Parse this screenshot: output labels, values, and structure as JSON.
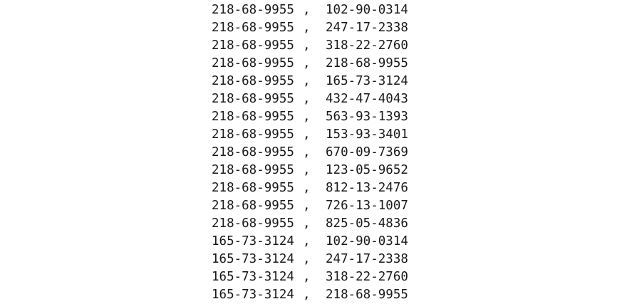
{
  "output": {
    "separator": ",",
    "rows": [
      {
        "left": "218-68-9955",
        "right": "102-90-0314"
      },
      {
        "left": "218-68-9955",
        "right": "247-17-2338"
      },
      {
        "left": "218-68-9955",
        "right": "318-22-2760"
      },
      {
        "left": "218-68-9955",
        "right": "218-68-9955"
      },
      {
        "left": "218-68-9955",
        "right": "165-73-3124"
      },
      {
        "left": "218-68-9955",
        "right": "432-47-4043"
      },
      {
        "left": "218-68-9955",
        "right": "563-93-1393"
      },
      {
        "left": "218-68-9955",
        "right": "153-93-3401"
      },
      {
        "left": "218-68-9955",
        "right": "670-09-7369"
      },
      {
        "left": "218-68-9955",
        "right": "123-05-9652"
      },
      {
        "left": "218-68-9955",
        "right": "812-13-2476"
      },
      {
        "left": "218-68-9955",
        "right": "726-13-1007"
      },
      {
        "left": "218-68-9955",
        "right": "825-05-4836"
      },
      {
        "left": "165-73-3124",
        "right": "102-90-0314"
      },
      {
        "left": "165-73-3124",
        "right": "247-17-2338"
      },
      {
        "left": "165-73-3124",
        "right": "318-22-2760"
      },
      {
        "left": "165-73-3124",
        "right": "218-68-9955"
      }
    ]
  }
}
